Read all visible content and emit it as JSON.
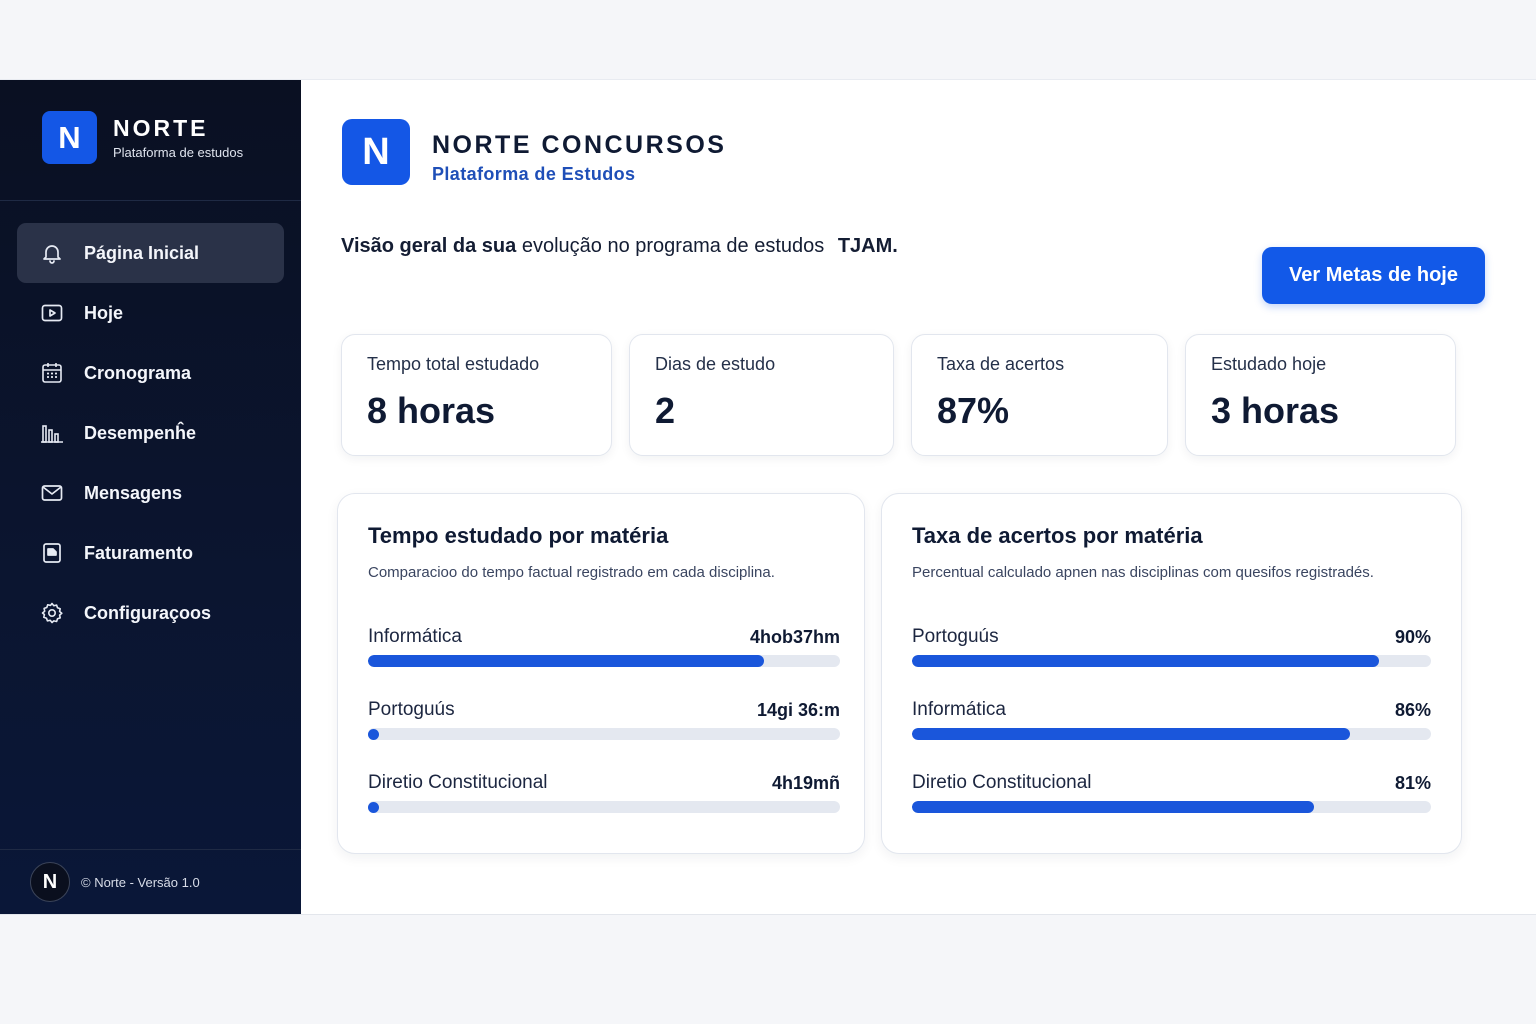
{
  "sidebar": {
    "logo_letter": "N",
    "brand_name": "NORTE",
    "brand_sub": "Plataforma de estudos",
    "items": [
      {
        "label": "Página Inicial",
        "icon": "bell-icon",
        "active": true
      },
      {
        "label": "Hoje",
        "icon": "play-square-icon",
        "active": false
      },
      {
        "label": "Cronograma",
        "icon": "calendar-icon",
        "active": false
      },
      {
        "label": "Desempenĥe",
        "icon": "bar-chart-icon",
        "active": false
      },
      {
        "label": "Mensagens",
        "icon": "mail-icon",
        "active": false
      },
      {
        "label": "Faturamento",
        "icon": "invoice-icon",
        "active": false
      },
      {
        "label": "Configuraçoos",
        "icon": "gear-icon",
        "active": false
      }
    ],
    "footer_logo_letter": "N",
    "footer_text": "© Norte - Versão 1.0"
  },
  "header": {
    "logo_letter": "N",
    "title": "NORTE CONCURSOS",
    "subtitle": "Plataforma de Estudos"
  },
  "overview": {
    "text_bold": "Visão geral da sua",
    "text_rest": " evolução no programa de estudos ",
    "program": "TJAM."
  },
  "cta": {
    "label": "Ver Metas de hoje"
  },
  "stats": [
    {
      "label": "Tempo total estudado",
      "value": "8 horas"
    },
    {
      "label": "Dias de estudo",
      "value": "2"
    },
    {
      "label": "Taxa de acertos",
      "value": "87%"
    },
    {
      "label": "Estudado hoje",
      "value": "3 horas"
    }
  ],
  "time_card": {
    "title": "Tempo estudado por matéria",
    "description": "Comparacioo do tempo factual registrado em cada disciplina.",
    "rows": [
      {
        "name": "Informática",
        "value": "4hob37hm",
        "fraction": 0.84
      },
      {
        "name": "Portoguús",
        "value": "14gi 36:m",
        "fraction": 0.02
      },
      {
        "name": "Diretio Constitucional",
        "value": "4h19mñ",
        "fraction": 0.02
      }
    ]
  },
  "rate_card": {
    "title": "Taxa de acertos por matéria",
    "description": "Percentual calculado apnen nas disciplinas com quesifos registradés.",
    "rows": [
      {
        "name": "Portoguús",
        "value": "90%",
        "fraction": 0.9
      },
      {
        "name": "Informática",
        "value": "86%",
        "fraction": 0.843
      },
      {
        "name": "Diretio Constitucional",
        "value": "81%",
        "fraction": 0.775
      }
    ]
  },
  "colors": {
    "accent": "#1457e6",
    "sidebar_bg": "#0b1530",
    "bar": "#1a56db"
  }
}
